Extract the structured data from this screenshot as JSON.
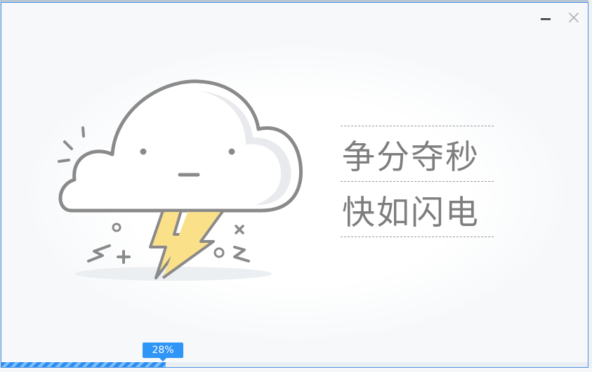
{
  "dialog": {
    "controls": {
      "minimize_icon": "minimize-icon",
      "close_icon": "close-icon"
    },
    "illustration_icon": "storm-cloud-lightning-icon",
    "slogan": {
      "line1": "争分夺秒",
      "line2": "快如闪电"
    },
    "progress": {
      "percent": 28,
      "label": "28%"
    }
  },
  "colors": {
    "border_accent": "#4a90e2",
    "progress_blue": "#2d8df0",
    "bolt_yellow": "#fbe08a",
    "cloud_outline": "#8a8a8a",
    "slogan_text": "#7e7e7e"
  }
}
